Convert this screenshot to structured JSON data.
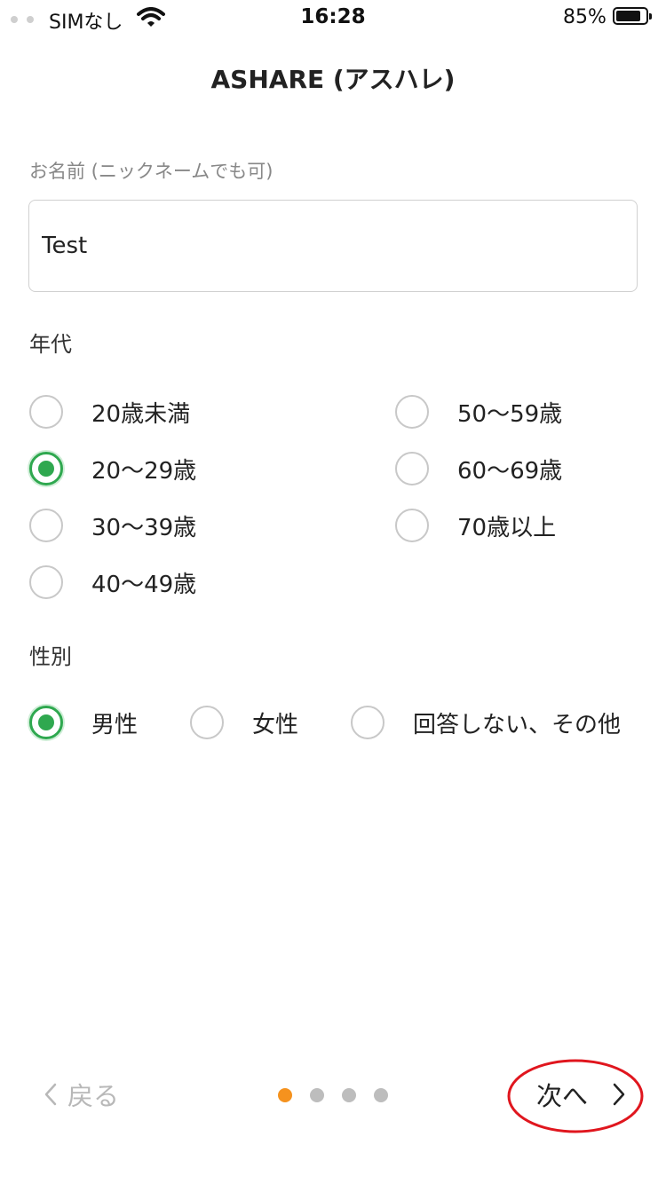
{
  "status_bar": {
    "carrier": "SIMなし",
    "time": "16:28",
    "battery": "85%",
    "battery_level": 0.85
  },
  "header": {
    "title": "ASHARE (アスハレ)"
  },
  "form": {
    "name": {
      "label": "お名前 (ニックネームでも可)",
      "value": "Test"
    },
    "age": {
      "label": "年代",
      "options": [
        "20歳未満",
        "20〜29歳",
        "30〜39歳",
        "40〜49歳",
        "50〜59歳",
        "60〜69歳",
        "70歳以上"
      ],
      "selected": "20〜29歳"
    },
    "gender": {
      "label": "性別",
      "options": [
        "男性",
        "女性",
        "回答しない、その他"
      ],
      "selected": "男性"
    }
  },
  "footer": {
    "back_label": "戻る",
    "next_label": "次へ",
    "pages": 4,
    "current_page": 1
  },
  "colors": {
    "accent_green": "#2fa84f",
    "active_dot": "#f5921e",
    "annotation_red": "#e0161e"
  }
}
